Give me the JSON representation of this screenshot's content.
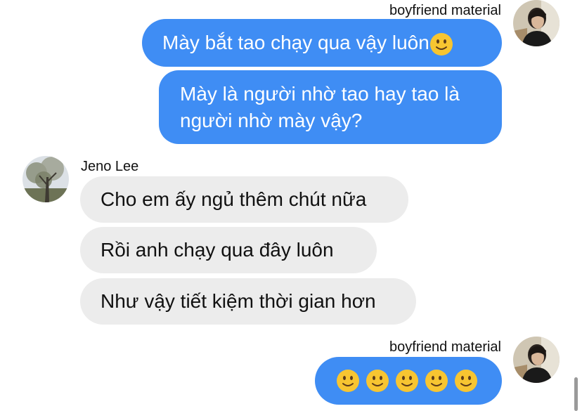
{
  "messages": [
    {
      "sender": "boyfriend material",
      "direction": "outgoing",
      "text": "Mày bắt tao chạy qua vậy luôn",
      "trailing_emoji": "slightly-smiling-face"
    },
    {
      "sender": "boyfriend material",
      "direction": "outgoing",
      "lines": [
        "Mày là người nhờ tao hay tao là",
        "người nhờ mày vậy?"
      ]
    },
    {
      "sender": "Jeno Lee",
      "direction": "incoming",
      "text": "Cho em ấy ngủ thêm chút nữa"
    },
    {
      "sender": "Jeno Lee",
      "direction": "incoming",
      "text": "Rồi anh chạy qua đây luôn"
    },
    {
      "sender": "Jeno Lee",
      "direction": "incoming",
      "text": "Như vậy tiết kiệm thời gian hơn"
    },
    {
      "sender": "boyfriend material",
      "direction": "outgoing",
      "emoji_count": 5,
      "emoji": "slightly-smiling-face"
    }
  ],
  "names": {
    "outgoing": "boyfriend material",
    "incoming": "Jeno Lee"
  },
  "colors": {
    "outgoing_bubble": "#3f8df4",
    "incoming_bubble": "#ececec",
    "emoji_face": "#f7c531"
  },
  "avatars": {
    "outgoing": "person-photo-avatar",
    "incoming": "tree-photo-avatar"
  }
}
